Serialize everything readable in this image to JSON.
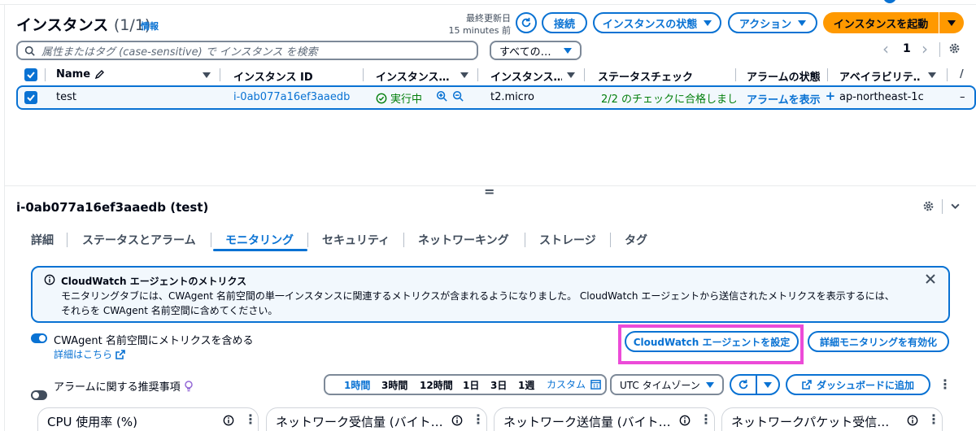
{
  "header": {
    "title": "インスタンス",
    "count": "(1/1)",
    "info_link": "情報",
    "last_updated_label": "最終更新日",
    "last_updated_value": "15 minutes 前",
    "connect_label": "接続",
    "instance_state_label": "インスタンスの状態",
    "actions_label": "アクション",
    "launch_label": "インスタンスを起動"
  },
  "search": {
    "placeholder": "属性またはタグ (case-sensitive) で インスタンス を検索",
    "filter_value": "すべての…"
  },
  "pagination": {
    "page": "1",
    "prev": "‹",
    "next": "›"
  },
  "table": {
    "columns": [
      "Name",
      "インスタンス ID",
      "インスタンス…",
      "インスタンス…",
      "ステータスチェック",
      "アラームの状態",
      "アベイラビリテ…"
    ],
    "rows": [
      {
        "name": "test",
        "instance_id": "i-0ab077a16ef3aaedb",
        "state": "実行中",
        "type": "t2.micro",
        "status_check": "2/2 のチェックに合格しまし",
        "alarm": "アラームを表示",
        "az": "ap-northeast-1c",
        "extra": "–"
      }
    ]
  },
  "splitter": {
    "handle": "="
  },
  "detail": {
    "title": "i-0ab077a16ef3aaedb (test)",
    "tabs": [
      "詳細",
      "ステータスとアラーム",
      "モニタリング",
      "セキュリティ",
      "ネットワーキング",
      "ストレージ",
      "タグ"
    ],
    "active_tab": "モニタリング"
  },
  "info_box": {
    "title": "CloudWatch エージェントのメトリクス",
    "line1": "モニタリングタブには、CWAgent 名前空間の単一インスタンスに関連するメトリクスが含まれるようになりました。 CloudWatch エージェントから送信されたメトリクスを表示するには、",
    "line2": "それらを CWAgent 名前空間に含めてください。"
  },
  "cwagent": {
    "toggle_label": "CWAgent 名前空間にメトリクスを含める",
    "learn_more": "詳細はこちら",
    "configure_button": "CloudWatch エージェントを設定",
    "detailed_button": "詳細モニタリングを有効化"
  },
  "alarm_rec": {
    "label": "アラームに関する推奨事項"
  },
  "time_range": {
    "options": [
      "1時間",
      "3時間",
      "12時間",
      "1日",
      "3日",
      "1週",
      "カスタム"
    ],
    "selected": "1時間",
    "timezone": "UTC タイムゾーン",
    "dashboard_button": "ダッシュボードに追加"
  },
  "metric_cards": [
    "CPU 使用率 (%)",
    "ネットワーク受信量 (バイト…",
    "ネットワーク送信量 (バイト…",
    "ネットワークパケット受信…"
  ],
  "colors": {
    "accent": "#0972d3",
    "primary": "#ff9900",
    "success": "#037f0c",
    "highlight": "#ec4bd8",
    "info_bg": "#f2f8fd"
  }
}
